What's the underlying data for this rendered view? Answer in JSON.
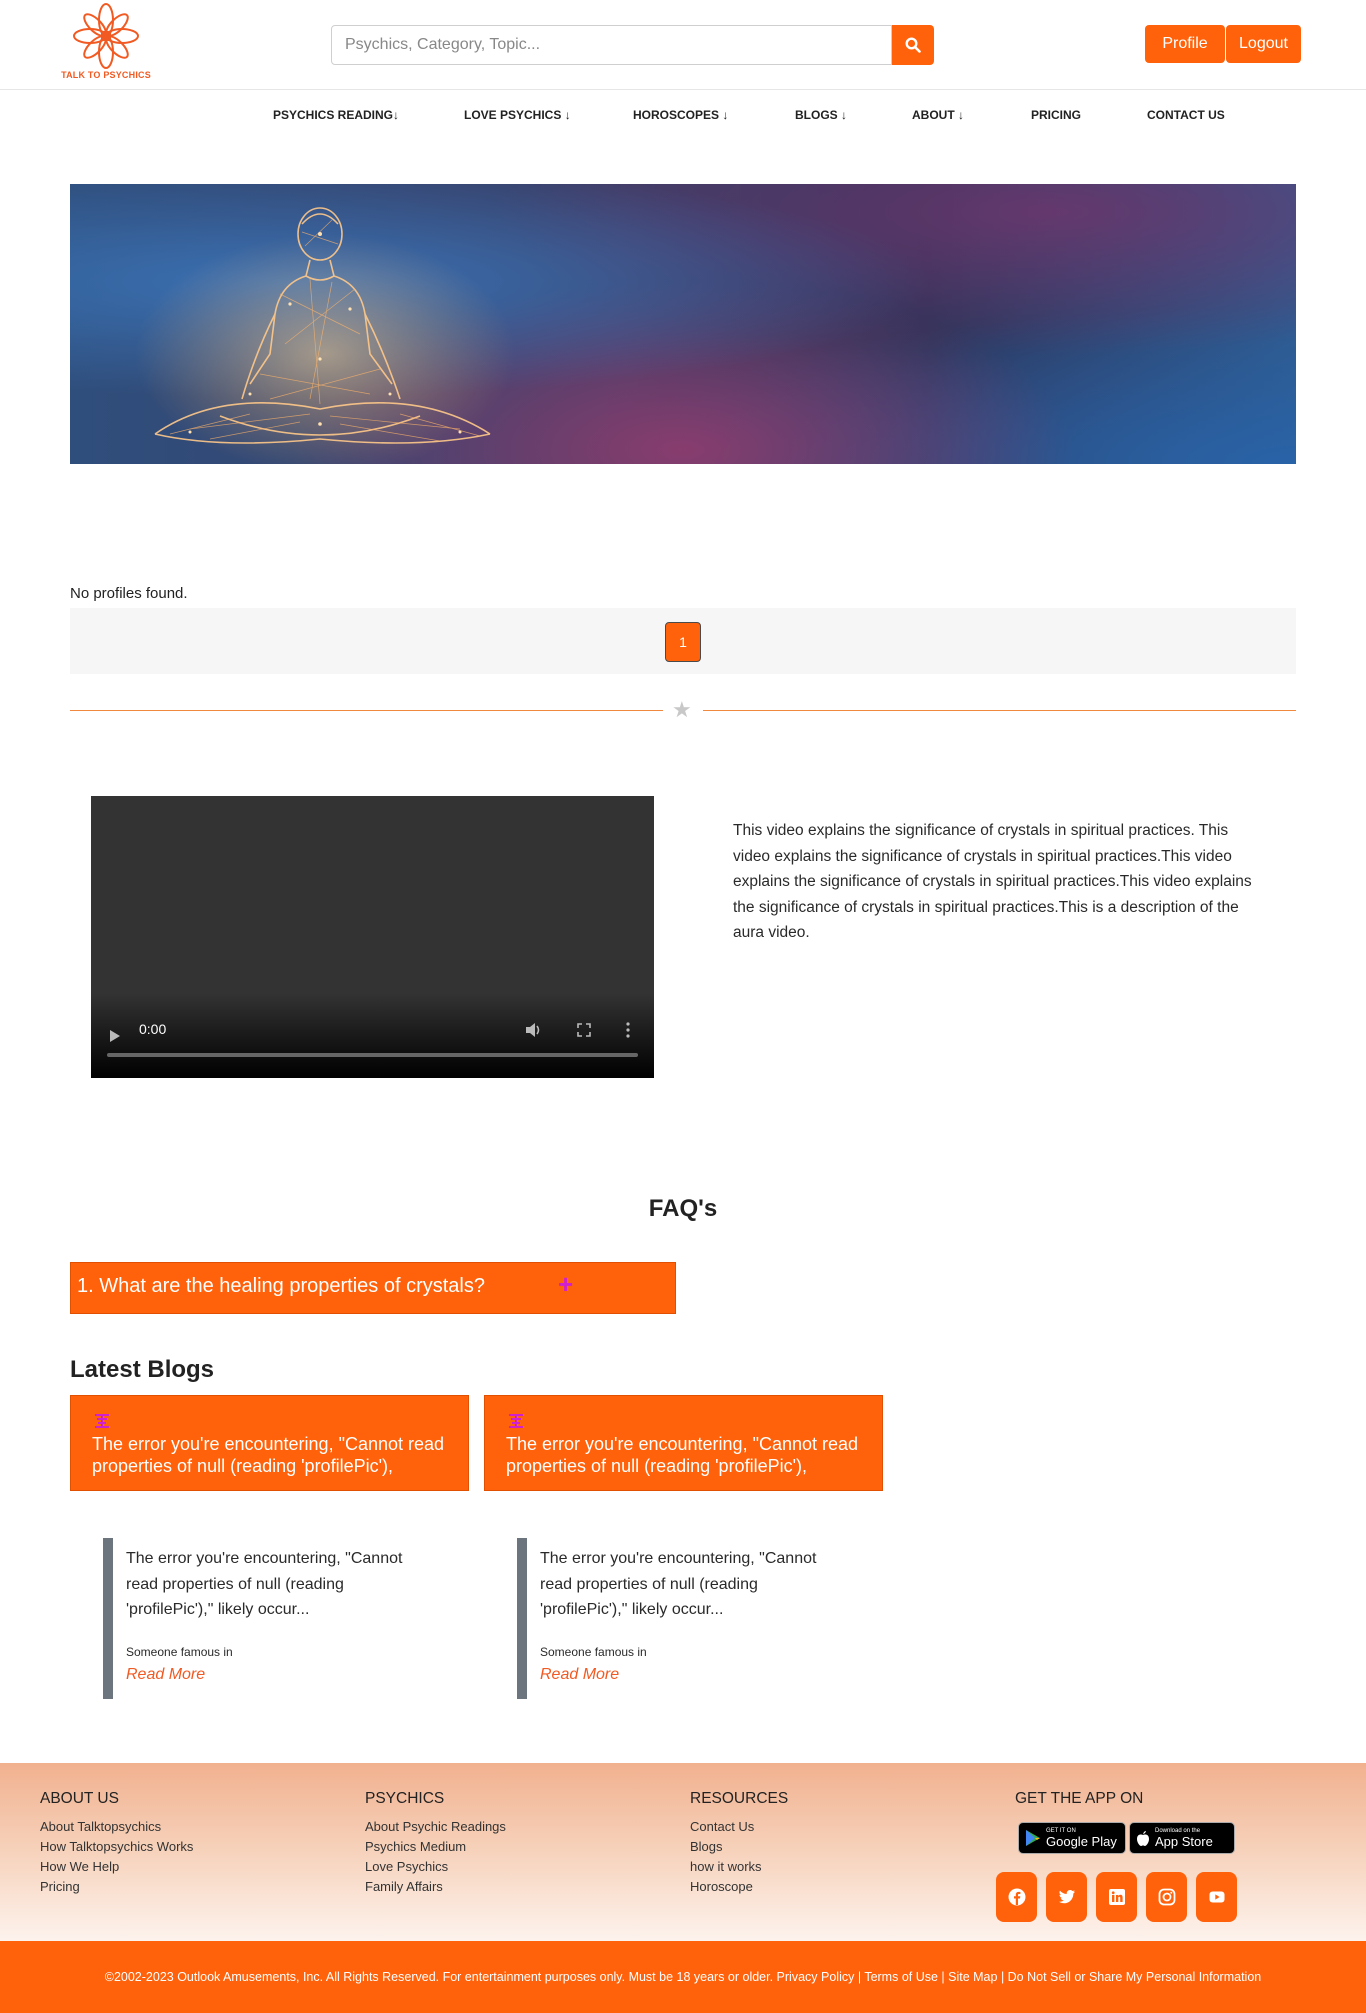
{
  "header": {
    "logo_text": "TALK TO PSYCHICS",
    "search_placeholder": "Psychics, Category, Topic...",
    "profile_label": "Profile",
    "logout_label": "Logout"
  },
  "nav": {
    "items": [
      "PSYCHICS READING↓",
      "LOVE PSYCHICS ↓",
      "HOROSCOPES ↓",
      "BLOGS ↓",
      "ABOUT ↓",
      "PRICING",
      "CONTACT US"
    ]
  },
  "profiles": {
    "empty_message": "No profiles found.",
    "current_page": "1"
  },
  "video": {
    "time": "0:00",
    "description": "This video explains the significance of crystals in spiritual practices. This video explains the significance of crystals in spiritual practices.This video explains the significance of crystals in spiritual practices.This video explains the significance of crystals in spiritual practices.This is a description of the aura video."
  },
  "faq": {
    "title": "FAQ's",
    "items": [
      {
        "question": "1. What are the healing properties of crystals?",
        "toggle": "+"
      }
    ]
  },
  "blogs": {
    "title": "Latest Blogs",
    "items": [
      {
        "title": "The error you're encountering, \"Cannot read properties of null (reading 'profilePic'),",
        "excerpt": "The error you're encountering, \"Cannot read properties of null (reading 'profilePic'),\" likely occur...",
        "author": "Someone famous in",
        "read_more": "Read More"
      },
      {
        "title": "The error you're encountering, \"Cannot read properties of null (reading 'profilePic'),",
        "excerpt": "The error you're encountering, \"Cannot read properties of null (reading 'profilePic'),\" likely occur...",
        "author": "Someone famous in",
        "read_more": "Read More"
      }
    ]
  },
  "footer": {
    "about": {
      "heading": "ABOUT US",
      "links": [
        "About Talktopsychics",
        "How Talktopsychics Works",
        "How We Help",
        "Pricing"
      ]
    },
    "psychics": {
      "heading": "PSYCHICS",
      "links": [
        "About Psychic Readings",
        "Psychics Medium",
        "Love Psychics",
        "Family Affairs"
      ]
    },
    "resources": {
      "heading": "RESOURCES",
      "links": [
        "Contact Us",
        "Blogs",
        "how it works",
        "Horoscope"
      ]
    },
    "app": {
      "heading": "GET THE APP ON",
      "google_small": "GET IT ON",
      "google_big": "Google Play",
      "apple_small": "Download on the",
      "apple_big": "App Store"
    },
    "social_icons": [
      "facebook-icon",
      "twitter-icon",
      "linkedin-icon",
      "instagram-icon",
      "youtube-icon"
    ],
    "copyright": "©2002-2023 Outlook Amusements, Inc. All Rights Reserved. For entertainment purposes only. Must be 18 years or older. Privacy Policy | Terms of Use | Site Map | Do Not Sell or Share My Personal Information"
  },
  "colors": {
    "accent": "#ff620b",
    "divider": "#f0893f",
    "faq_toggle": "#d020d0"
  }
}
